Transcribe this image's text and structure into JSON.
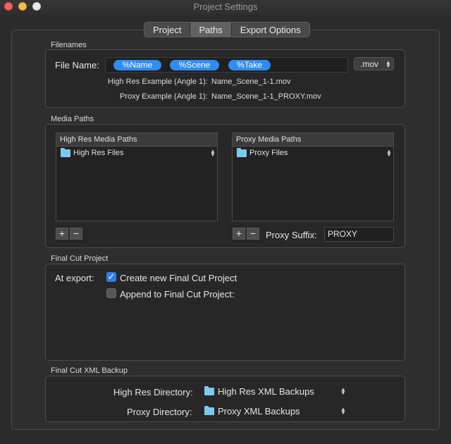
{
  "window": {
    "title": "Project Settings"
  },
  "tabs": [
    {
      "label": "Project",
      "active": false
    },
    {
      "label": "Paths",
      "active": true
    },
    {
      "label": "Export Options",
      "active": false
    }
  ],
  "filenames": {
    "section_title": "Filenames",
    "file_name_label": "File Name:",
    "tokens": [
      "%Name",
      "%Scene",
      "%Take"
    ],
    "extension": ".mov",
    "high_res_example_label": "High Res Example (Angle 1):",
    "high_res_example_value": "Name_Scene_1-1.mov",
    "proxy_example_label": "Proxy Example (Angle 1):",
    "proxy_example_value": "Name_Scene_1-1_PROXY.mov"
  },
  "media_paths": {
    "section_title": "Media Paths",
    "high_res_header": "High Res Media Paths",
    "high_res_item": "High Res Files",
    "proxy_header": "Proxy Media Paths",
    "proxy_item": "Proxy Files",
    "add_symbol": "+",
    "remove_symbol": "−",
    "proxy_suffix_label": "Proxy Suffix:",
    "proxy_suffix_value": "PROXY"
  },
  "final_cut_project": {
    "section_title": "Final Cut Project",
    "at_export_label": "At export:",
    "create_new_label": "Create new Final Cut Project",
    "create_new_checked": true,
    "append_label": "Append to Final Cut Project:",
    "append_checked": false
  },
  "xml_backup": {
    "section_title": "Final Cut XML Backup",
    "high_res_dir_label": "High Res Directory:",
    "high_res_dir_value": "High Res XML Backups",
    "proxy_dir_label": "Proxy Directory:",
    "proxy_dir_value": "Proxy XML Backups"
  },
  "icons": {
    "checkmark": "✓",
    "updown": "▲▼",
    "folder": "folder-icon"
  },
  "colors": {
    "token_blue": "#2f8cf0",
    "folder_blue": "#7cc9f0",
    "checkbox_blue": "#2f7fe6"
  }
}
